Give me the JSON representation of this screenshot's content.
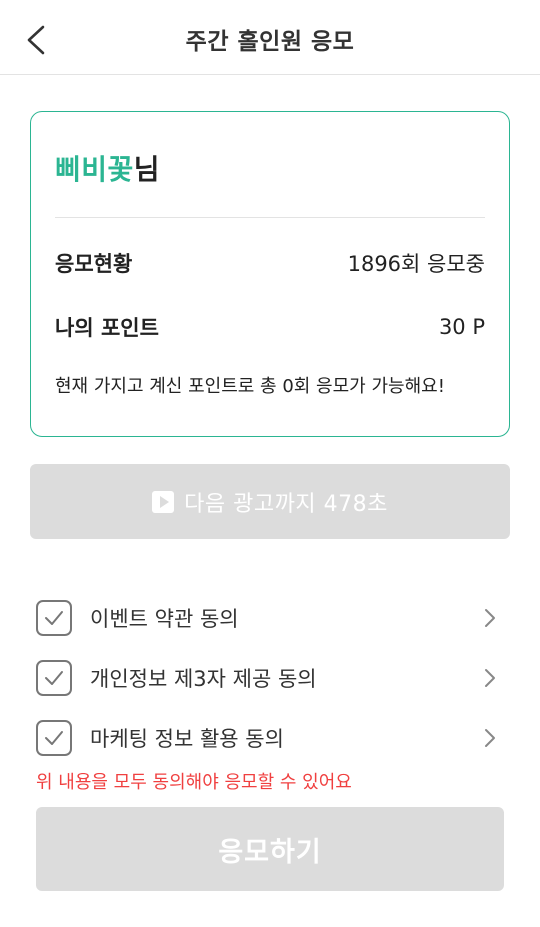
{
  "header": {
    "title": "주간 홀인원 응모",
    "back_icon": "chevron-left-icon"
  },
  "card": {
    "user_name": "삐비꽃",
    "user_suffix": "님",
    "status_label": "응모현황",
    "status_value": "1896회 응모중",
    "points_label": "나의 포인트",
    "points_value": "30 P",
    "note": "현재 가지고 계신 포인트로 총 0회 응모가 가능해요!",
    "accent_color": "#2bb592"
  },
  "ad_button": {
    "icon": "play-icon",
    "label": "다음 광고까지 478초"
  },
  "agreements": [
    {
      "label": "이벤트 약관 동의",
      "checked": true
    },
    {
      "label": "개인정보 제3자 제공 동의",
      "checked": true
    },
    {
      "label": "마케팅 정보 활용 동의",
      "checked": true
    }
  ],
  "warning": "위 내용을 모두 동의해야 응모할 수 있어요",
  "warning_color": "#f04040",
  "submit": {
    "label": "응모하기",
    "disabled": true
  }
}
